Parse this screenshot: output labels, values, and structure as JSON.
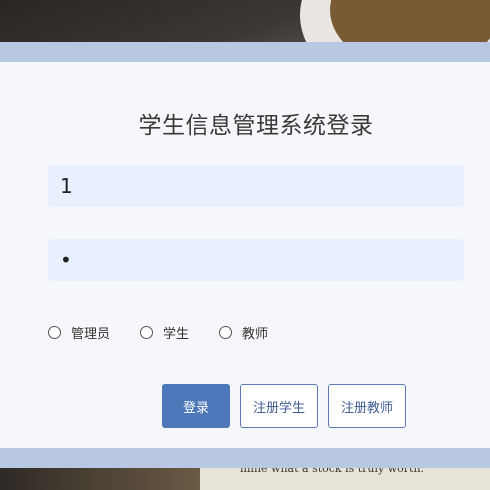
{
  "login": {
    "title": "学生信息管理系统登录",
    "username_value": "1",
    "password_value": "•",
    "roles": [
      {
        "label": "管理员"
      },
      {
        "label": "学生"
      },
      {
        "label": "教师"
      }
    ],
    "buttons": {
      "login": "登录",
      "register_student": "注册学生",
      "register_teacher": "注册教师"
    }
  },
  "background": {
    "book_text": "mine what a stock is truly worth."
  },
  "colors": {
    "band": "#b8c7e2",
    "input_bg": "#e8f0fe",
    "primary": "#4f78ba"
  }
}
